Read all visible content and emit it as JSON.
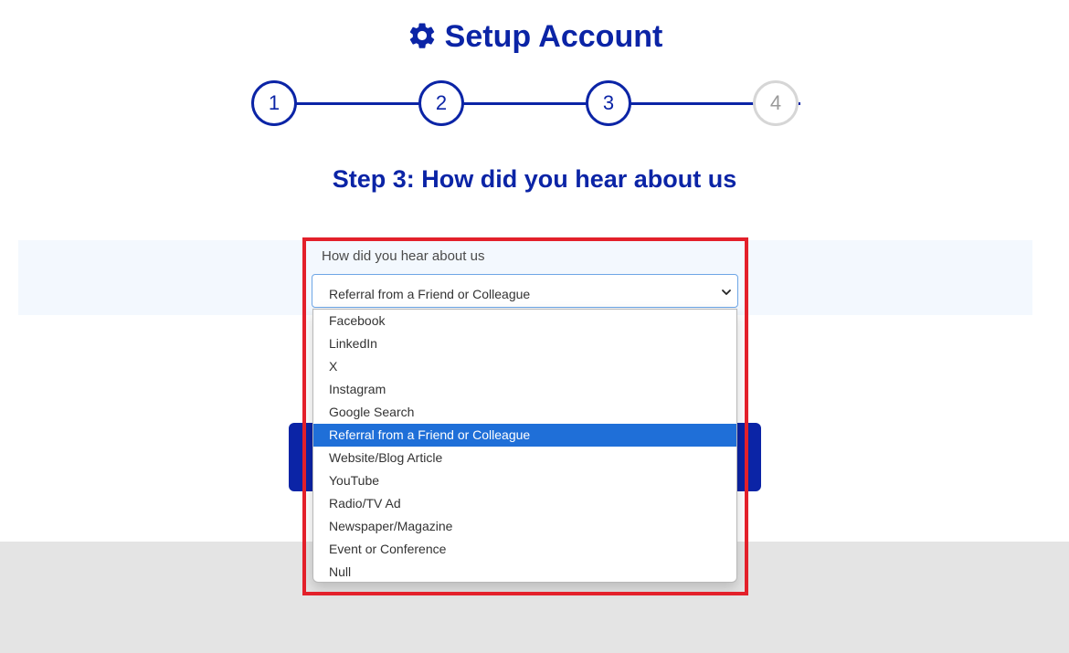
{
  "header": {
    "title": "Setup Account",
    "icon": "gear-icon"
  },
  "stepper": {
    "steps": [
      {
        "label": "1",
        "state": "complete"
      },
      {
        "label": "2",
        "state": "complete"
      },
      {
        "label": "3",
        "state": "current"
      },
      {
        "label": "4",
        "state": "pending"
      }
    ]
  },
  "step_heading": "Step 3: How did you hear about us",
  "form": {
    "field_label": "How did you hear about us",
    "selected_value": "Referral from a Friend or Colleague",
    "options": [
      "Facebook",
      "LinkedIn",
      "X",
      "Instagram",
      "Google Search",
      "Referral from a Friend or Colleague",
      "Website/Blog Article",
      "YouTube",
      "Radio/TV Ad",
      "Newspaper/Magazine",
      "Event or Conference",
      "Null"
    ],
    "selected_index": 5
  },
  "colors": {
    "brand": "#0b24a6",
    "highlight_option": "#1f6fd8",
    "annotation_border": "#e3202a",
    "panel_bg": "#f3f8fe"
  }
}
